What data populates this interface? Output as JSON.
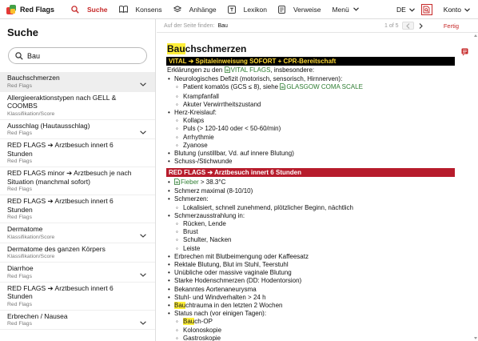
{
  "app": {
    "name": "Red Flags"
  },
  "nav": [
    {
      "label": "Suche",
      "icon": "search-icon",
      "active": true
    },
    {
      "label": "Konsens",
      "icon": "book-icon"
    },
    {
      "label": "Anhänge",
      "icon": "layers-icon"
    },
    {
      "label": "Lexikon",
      "icon": "lexicon-icon"
    },
    {
      "label": "Verweise",
      "icon": "document-icon"
    },
    {
      "label": "Menü",
      "icon": "chevron-down-icon"
    }
  ],
  "header_right": {
    "language": "DE",
    "account": "Konto"
  },
  "sidebar": {
    "title": "Suche",
    "search_value": "Bau",
    "results": [
      {
        "title": "Bauchschmerzen",
        "subtitle": "Red Flags",
        "expandable": true,
        "active": true
      },
      {
        "title": "Allergieeraktionstypen nach GELL & COOMBS",
        "subtitle": "Klassifikation/Score",
        "expandable": false
      },
      {
        "title": "Ausschlag (Hautausschlag)",
        "subtitle": "Red Flags",
        "expandable": true
      },
      {
        "title": "RED FLAGS ➔ Arztbesuch innert 6 Stunden",
        "subtitle": "Red Flags",
        "expandable": false
      },
      {
        "title": "RED FLAGS minor ➔ Arztbesuch je nach Situation (manchmal sofort)",
        "subtitle": "Red Flags",
        "expandable": false
      },
      {
        "title": "RED FLAGS ➔ Arztbesuch innert 6 Stunden",
        "subtitle": "Red Flags",
        "expandable": false
      },
      {
        "title": "Dermatome",
        "subtitle": "Klassifikation/Score",
        "expandable": true
      },
      {
        "title": "Dermatome des ganzen Körpers",
        "subtitle": "Klassifikation/Score",
        "expandable": false
      },
      {
        "title": "Diarrhoe",
        "subtitle": "Red Flags",
        "expandable": true
      },
      {
        "title": "RED FLAGS ➔ Arztbesuch innert 6 Stunden",
        "subtitle": "Red Flags",
        "expandable": false
      },
      {
        "title": "Erbrechen / Nausea",
        "subtitle": "Red Flags",
        "expandable": true
      }
    ]
  },
  "findbar": {
    "label": "Auf der Seite finden:",
    "value": "Bau",
    "count": "1 of 5",
    "done": "Fertig"
  },
  "doc": {
    "title_highlight": "Bau",
    "title_rest": "chschmerzen",
    "section_vital": {
      "prefix": "VITAL ➔ ",
      "text": "Spitaleinweisung SOFORT + CPR-Bereitschaft"
    },
    "section_red": {
      "text": "RED FLAGS ➔ Arztbesuch innert 6 Stunden"
    },
    "vital_lines": [
      {
        "lv": 0,
        "parts": [
          {
            "t": "Erklärungen zu den "
          },
          {
            "t": "VITAL FLAGS",
            "link": true
          },
          {
            "t": ", insbesondere:"
          }
        ]
      },
      {
        "lv": 1,
        "parts": [
          {
            "t": "Neurologisches Defizit (motorisch, sensorisch, Hirnnerven):"
          }
        ]
      },
      {
        "lv": 2,
        "parts": [
          {
            "t": "Patient komatös (GCS ≤ 8), siehe "
          },
          {
            "t": "GLASGOW COMA SCALE",
            "link": true
          }
        ]
      },
      {
        "lv": 2,
        "parts": [
          {
            "t": "Krampfanfall"
          }
        ]
      },
      {
        "lv": 2,
        "parts": [
          {
            "t": "Akuter Verwirrtheitszustand"
          }
        ]
      },
      {
        "lv": 1,
        "parts": [
          {
            "t": "Herz-Kreislauf:"
          }
        ]
      },
      {
        "lv": 2,
        "parts": [
          {
            "t": "Kollaps"
          }
        ]
      },
      {
        "lv": 2,
        "parts": [
          {
            "t": "Puls (> 120-140 oder < 50-60/min)"
          }
        ]
      },
      {
        "lv": 2,
        "parts": [
          {
            "t": "Arrhythmie"
          }
        ]
      },
      {
        "lv": 2,
        "parts": [
          {
            "t": "Zyanose"
          }
        ]
      },
      {
        "lv": 1,
        "parts": [
          {
            "t": "Blutung (unstillbar, Vd. auf innere Blutung)"
          }
        ]
      },
      {
        "lv": 1,
        "parts": [
          {
            "t": "Schuss-/Stichwunde"
          }
        ]
      }
    ],
    "red_lines": [
      {
        "lv": 1,
        "parts": [
          {
            "t": "Fieber",
            "link": true
          },
          {
            "t": " > 38.3°C"
          }
        ]
      },
      {
        "lv": 1,
        "parts": [
          {
            "t": "Schmerz maximal (8-10/10)"
          }
        ]
      },
      {
        "lv": 1,
        "parts": [
          {
            "t": "Schmerzen:"
          }
        ]
      },
      {
        "lv": 2,
        "parts": [
          {
            "t": "Lokalisiert, schnell zunehmend, plötzlicher Beginn, nächtlich"
          }
        ]
      },
      {
        "lv": 1,
        "parts": [
          {
            "t": "Schmerzausstrahlung in:"
          }
        ]
      },
      {
        "lv": 2,
        "parts": [
          {
            "t": "Rücken, Lende"
          }
        ]
      },
      {
        "lv": 2,
        "parts": [
          {
            "t": "Brust"
          }
        ]
      },
      {
        "lv": 2,
        "parts": [
          {
            "t": "Schulter, Nacken"
          }
        ]
      },
      {
        "lv": 2,
        "parts": [
          {
            "t": "Leiste"
          }
        ]
      },
      {
        "lv": 1,
        "parts": [
          {
            "t": "Erbrechen mit Blutbeimengung oder Kaffeesatz"
          }
        ]
      },
      {
        "lv": 1,
        "parts": [
          {
            "t": "Rektale Blutung, Blut im Stuhl, Teerstuhl"
          }
        ]
      },
      {
        "lv": 1,
        "parts": [
          {
            "t": "Unübliche oder massive vaginale Blutung"
          }
        ]
      },
      {
        "lv": 1,
        "parts": [
          {
            "t": "Starke Hodenschmerzen (DD: Hodentorsion)"
          }
        ]
      },
      {
        "lv": 1,
        "parts": [
          {
            "t": "Bekanntes Aortenaneurysma"
          }
        ]
      },
      {
        "lv": 1,
        "parts": [
          {
            "t": "Stuhl- und Windverhalten > 24 h"
          }
        ]
      },
      {
        "lv": 1,
        "parts": [
          {
            "t": "Bau",
            "hl": true
          },
          {
            "t": "chtrauma in den letzten 2 Wochen"
          }
        ]
      },
      {
        "lv": 1,
        "parts": [
          {
            "t": "Status nach (vor einigen Tagen):"
          }
        ]
      },
      {
        "lv": 2,
        "parts": [
          {
            "t": "Bau",
            "hl": true
          },
          {
            "t": "ch-OP"
          }
        ]
      },
      {
        "lv": 2,
        "parts": [
          {
            "t": "Kolonoskopie"
          }
        ]
      },
      {
        "lv": 2,
        "parts": [
          {
            "t": "Gastroskopie"
          }
        ]
      }
    ]
  },
  "colors": {
    "accent": "#c62828",
    "vital_bg": "#000000",
    "vital_highlight": "#fdd835",
    "red_bg": "#b71c2c",
    "search_highlight": "#ffef3a",
    "link": "#2e7d32"
  }
}
